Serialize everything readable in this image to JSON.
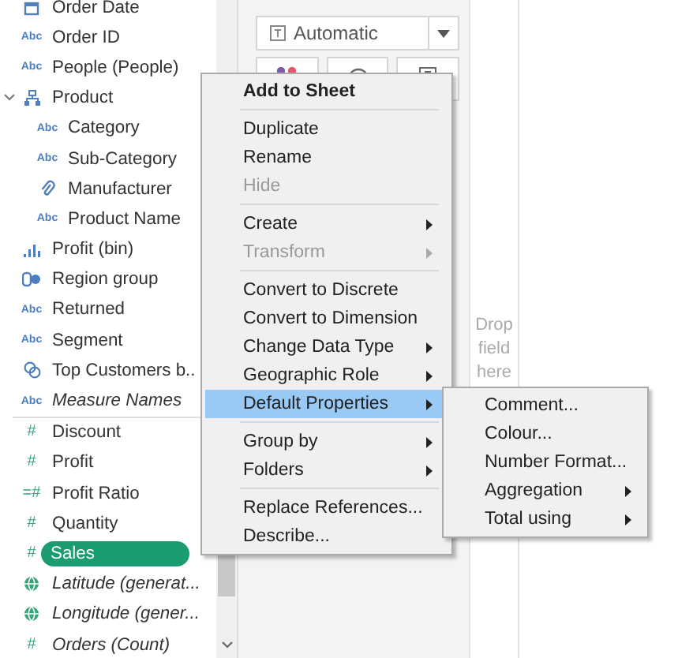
{
  "data_pane": {
    "fields": [
      {
        "label": "Order Date",
        "kind": "date",
        "italic": false,
        "selected": false
      },
      {
        "label": "Order ID",
        "kind": "text",
        "glyph": "Abc",
        "italic": false,
        "selected": false
      },
      {
        "label": "People (People)",
        "kind": "text",
        "glyph": "Abc",
        "italic": false,
        "selected": false
      },
      {
        "label": "Product",
        "kind": "hierarchy",
        "italic": false,
        "selected": false,
        "expanded": true,
        "children": [
          {
            "label": "Category",
            "kind": "text",
            "glyph": "Abc",
            "italic": false,
            "selected": false
          },
          {
            "label": "Sub-Category",
            "kind": "text",
            "glyph": "Abc",
            "italic": false,
            "selected": false
          },
          {
            "label": "Manufacturer",
            "kind": "clip",
            "italic": false,
            "selected": false
          },
          {
            "label": "Product Name",
            "kind": "text",
            "glyph": "Abc",
            "italic": false,
            "selected": false
          }
        ]
      },
      {
        "label": "Profit (bin)",
        "kind": "bin",
        "italic": false,
        "selected": false
      },
      {
        "label": "Region group",
        "kind": "group",
        "italic": false,
        "selected": false
      },
      {
        "label": "Returned",
        "kind": "text",
        "glyph": "Abc",
        "italic": false,
        "selected": false
      },
      {
        "label": "Segment",
        "kind": "text",
        "glyph": "Abc",
        "italic": false,
        "selected": false
      },
      {
        "label": "Top Customers b..",
        "kind": "set",
        "italic": false,
        "selected": false
      },
      {
        "label": "Measure Names",
        "kind": "text",
        "glyph": "Abc",
        "italic": true,
        "selected": false
      },
      {
        "kind": "divider"
      },
      {
        "label": "Discount",
        "kind": "measure",
        "glyph": "#",
        "italic": false,
        "selected": false
      },
      {
        "label": "Profit",
        "kind": "measure",
        "glyph": "#",
        "italic": false,
        "selected": false
      },
      {
        "label": "Profit Ratio",
        "kind": "measure",
        "glyph": "=#",
        "italic": false,
        "selected": false
      },
      {
        "label": "Quantity",
        "kind": "measure",
        "glyph": "#",
        "italic": false,
        "selected": false
      },
      {
        "label": "Sales",
        "kind": "measure",
        "glyph": "#",
        "italic": false,
        "selected": true
      },
      {
        "label": "Latitude (generat...",
        "kind": "geo",
        "italic": true,
        "selected": false
      },
      {
        "label": "Longitude (gener...",
        "kind": "geo",
        "italic": true,
        "selected": false
      },
      {
        "label": "Orders (Count)",
        "kind": "measure",
        "glyph": "#",
        "italic": true,
        "selected": false
      }
    ]
  },
  "marks": {
    "mark_type": "Automatic"
  },
  "drop_zone": {
    "hint": "Drop field here"
  },
  "context_menu": {
    "sections": [
      [
        {
          "label": "Add to Sheet",
          "bold": true,
          "disabled": false,
          "submenu": false,
          "selected": false
        }
      ],
      [
        {
          "label": "Duplicate",
          "bold": false,
          "disabled": false,
          "submenu": false,
          "selected": false
        },
        {
          "label": "Rename",
          "bold": false,
          "disabled": false,
          "submenu": false,
          "selected": false
        },
        {
          "label": "Hide",
          "bold": false,
          "disabled": true,
          "submenu": false,
          "selected": false
        }
      ],
      [
        {
          "label": "Create",
          "bold": false,
          "disabled": false,
          "submenu": true,
          "selected": false
        },
        {
          "label": "Transform",
          "bold": false,
          "disabled": true,
          "submenu": true,
          "selected": false
        }
      ],
      [
        {
          "label": "Convert to Discrete",
          "bold": false,
          "disabled": false,
          "submenu": false,
          "selected": false
        },
        {
          "label": "Convert to Dimension",
          "bold": false,
          "disabled": false,
          "submenu": false,
          "selected": false
        },
        {
          "label": "Change Data Type",
          "bold": false,
          "disabled": false,
          "submenu": true,
          "selected": false
        },
        {
          "label": "Geographic Role",
          "bold": false,
          "disabled": false,
          "submenu": true,
          "selected": false
        },
        {
          "label": "Default Properties",
          "bold": false,
          "disabled": false,
          "submenu": true,
          "selected": true
        }
      ],
      [
        {
          "label": "Group by",
          "bold": false,
          "disabled": false,
          "submenu": true,
          "selected": false
        },
        {
          "label": "Folders",
          "bold": false,
          "disabled": false,
          "submenu": true,
          "selected": false
        }
      ],
      [
        {
          "label": "Replace References...",
          "bold": false,
          "disabled": false,
          "submenu": false,
          "selected": false
        },
        {
          "label": "Describe...",
          "bold": false,
          "disabled": false,
          "submenu": false,
          "selected": false
        }
      ]
    ]
  },
  "submenu": {
    "items": [
      {
        "label": "Comment...",
        "submenu": false
      },
      {
        "label": "Colour...",
        "submenu": false
      },
      {
        "label": "Number Format...",
        "submenu": false
      },
      {
        "label": "Aggregation",
        "submenu": true
      },
      {
        "label": "Total using",
        "submenu": true
      }
    ]
  }
}
